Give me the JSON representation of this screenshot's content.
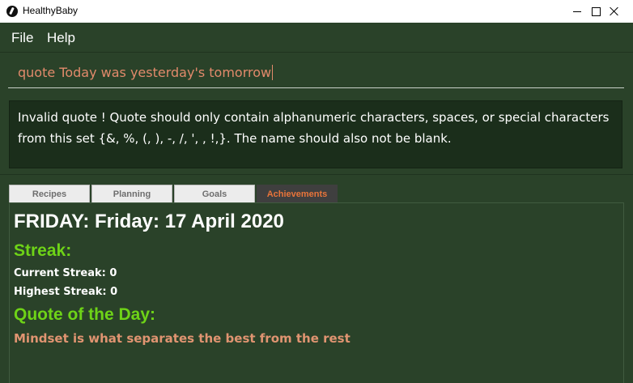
{
  "window": {
    "title": "HealthyBaby",
    "icon": "app-logo-icon"
  },
  "menu": {
    "file": "File",
    "help": "Help"
  },
  "command": {
    "value": "quote Today was yesterday's tomorrow"
  },
  "result": {
    "message": "Invalid quote ! Quote should only contain alphanumeric characters, spaces, or special characters from this set {&, %, (, ), -, /, ', , !,}. The name should also not be blank."
  },
  "tabs": [
    {
      "label": "Recipes",
      "selected": false
    },
    {
      "label": "Planning",
      "selected": false
    },
    {
      "label": "Goals",
      "selected": false
    },
    {
      "label": "Achievements",
      "selected": true
    }
  ],
  "achievements": {
    "date": "FRIDAY: Friday: 17 April 2020",
    "streak_heading": "Streak:",
    "current_streak": "Current Streak: 0",
    "highest_streak": "Highest Streak: 0",
    "quote_heading": "Quote of the Day:",
    "quote": "Mindset is what separates the best from the rest"
  },
  "colors": {
    "background": "#2a4229",
    "result_background": "#1b2e1b",
    "heading_green": "#6ed317",
    "quote_orange": "#e09471",
    "command_text": "#e28a6b",
    "active_tab_text": "#e8743a"
  }
}
